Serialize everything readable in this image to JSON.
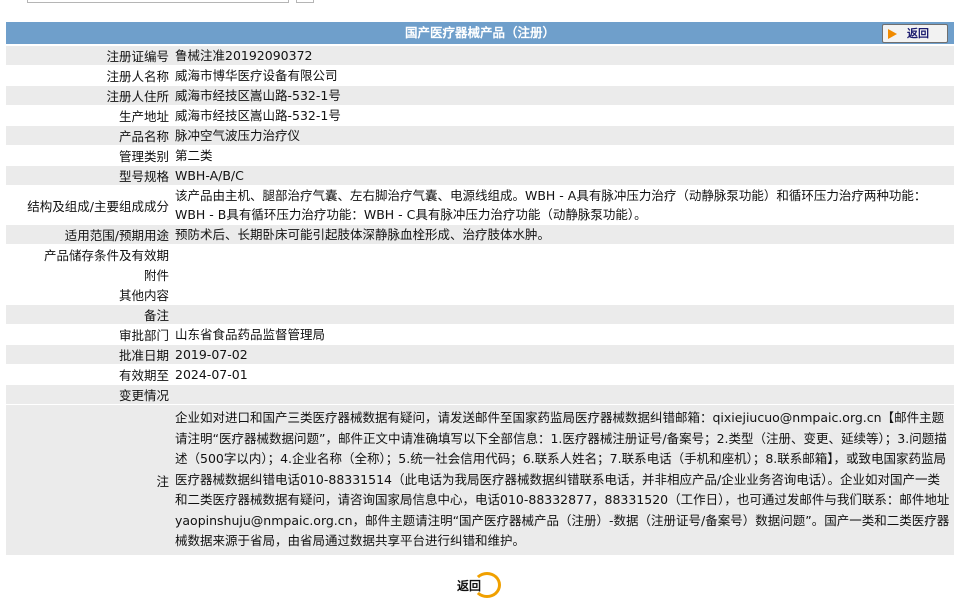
{
  "header": {
    "title": "国产医疗器械产品（注册）",
    "back_label": "返回"
  },
  "rows": [
    {
      "label": "注册证编号",
      "value": "鲁械注准20192090372"
    },
    {
      "label": "注册人名称",
      "value": "威海市博华医疗设备有限公司"
    },
    {
      "label": "注册人住所",
      "value": "威海市经技区嵩山路-532-1号"
    },
    {
      "label": "生产地址",
      "value": "威海市经技区嵩山路-532-1号"
    },
    {
      "label": "产品名称",
      "value": "脉冲空气波压力治疗仪"
    },
    {
      "label": "管理类别",
      "value": "第二类"
    },
    {
      "label": "型号规格",
      "value": "WBH-A/B/C"
    },
    {
      "label": "结构及组成/主要组成成分",
      "value": "该产品由主机、腿部治疗气囊、左右脚治疗气囊、电源线组成。WBH - A具有脉冲压力治疗（动静脉泵功能）和循环压力治疗两种功能：WBH - B具有循环压力治疗功能：WBH - C具有脉冲压力治疗功能（动静脉泵功能）。"
    },
    {
      "label": "适用范围/预期用途",
      "value": "预防术后、长期卧床可能引起肢体深静脉血栓形成、治疗肢体水肿。"
    },
    {
      "label": "产品储存条件及有效期",
      "value": ""
    },
    {
      "label": "附件",
      "value": ""
    },
    {
      "label": "其他内容",
      "value": ""
    },
    {
      "label": "备注",
      "value": ""
    },
    {
      "label": "审批部门",
      "value": "山东省食品药品监督管理局"
    },
    {
      "label": "批准日期",
      "value": "2019-07-02"
    },
    {
      "label": "有效期至",
      "value": "2024-07-01"
    },
    {
      "label": "变更情况",
      "value": ""
    },
    {
      "label": "注",
      "value": "企业如对进口和国产三类医疗器械数据有疑问，请发送邮件至国家药监局医疗器械数据纠错邮箱：qixiejiucuo@nmpaic.org.cn【邮件主题请注明“医疗器械数据问题”，邮件正文中请准确填写以下全部信息：1.医疗器械注册证号/备案号；2.类型（注册、变更、延续等）；3.问题描述（500字以内）；4.企业名称（全称）；5.统一社会信用代码；6.联系人姓名；7.联系电话（手机和座机）；8.联系邮箱】，或致电国家药监局医疗器械数据纠错电话010-88331514（此电话为我局医疗器械数据纠错联系电话，并非相应产品/企业业务咨询电话）。企业如对国产一类和二类医疗器械数据有疑问，请咨询国家局信息中心，电话010-88332877，88331520（工作日），也可通过发邮件与我们联系：邮件地址yaopinshuju@nmpaic.org.cn，邮件主题请注明“国产医疗器械产品（注册）-数据（注册证号/备案号）数据问题”。国产一类和二类医疗器械数据来源于省局，由省局通过数据共享平台进行纠错和维护。"
    }
  ],
  "footer": {
    "back_label": "返回"
  }
}
